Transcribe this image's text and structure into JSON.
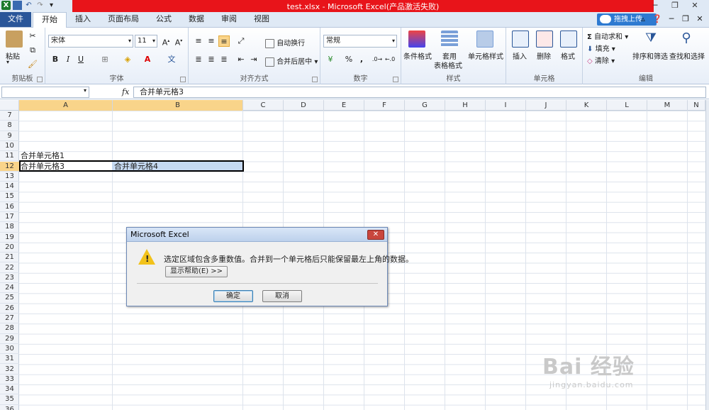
{
  "window": {
    "title": "test.xlsx - Microsoft Excel(产品激活失败)"
  },
  "ribbon_tabs": {
    "file": "文件",
    "tabs": [
      "开始",
      "插入",
      "页面布局",
      "公式",
      "数据",
      "审阅",
      "视图"
    ],
    "active": "开始",
    "cloud_upload": "拖拽上传"
  },
  "ribbon": {
    "clipboard": {
      "label": "剪贴板",
      "paste": "粘贴"
    },
    "font": {
      "label": "字体",
      "font_name": "宋体",
      "font_size": "11",
      "bold": "B",
      "italic": "I",
      "underline": "U"
    },
    "alignment": {
      "label": "对齐方式",
      "wrap": "自动换行",
      "merge": "合并后居中"
    },
    "number": {
      "label": "数字",
      "format": "常规",
      "percent": "%",
      "comma": ","
    },
    "styles": {
      "label": "样式",
      "conditional": "条件格式",
      "table_format_1": "套用",
      "table_format_2": "表格格式",
      "cell_styles": "单元格样式"
    },
    "cells": {
      "label": "单元格",
      "insert": "插入",
      "delete": "删除",
      "format": "格式"
    },
    "editing": {
      "label": "编辑",
      "autosum": "自动求和",
      "fill": "填充",
      "clear": "清除",
      "sort_filter": "排序和筛选",
      "find_select": "查找和选择"
    }
  },
  "formula_bar": {
    "fx": "fx",
    "content": "合并单元格3"
  },
  "grid": {
    "columns": [
      "A",
      "B",
      "C",
      "D",
      "E",
      "F",
      "G",
      "H",
      "I",
      "J",
      "K",
      "L",
      "M",
      "N"
    ],
    "rows": [
      "7",
      "8",
      "9",
      "10",
      "11",
      "12",
      "13",
      "14",
      "15",
      "16",
      "17",
      "18",
      "19",
      "20",
      "21",
      "22",
      "23",
      "24",
      "25",
      "26",
      "27",
      "28",
      "29",
      "30",
      "31",
      "32",
      "33",
      "34",
      "35",
      "36"
    ],
    "selected_row": "12",
    "cells": {
      "A11": "合并单元格1",
      "A12": "合并单元格3",
      "B12": "合并单元格4"
    }
  },
  "dialog": {
    "title": "Microsoft Excel",
    "message": "选定区域包含多重数值。合并到一个单元格后只能保留最左上角的数据。",
    "help_button": "显示帮助(E) >>",
    "ok_button": "确定",
    "cancel_button": "取消",
    "close": "✕"
  },
  "watermark": {
    "logo": "Bai 经验",
    "url": "jingyan.baidu.com"
  },
  "colors": {
    "title_accent": "#e8141a",
    "file_tab": "#2a5699",
    "selection_highlight": "#f9d48a",
    "selected_cell_fill": "#c5d9f1"
  }
}
